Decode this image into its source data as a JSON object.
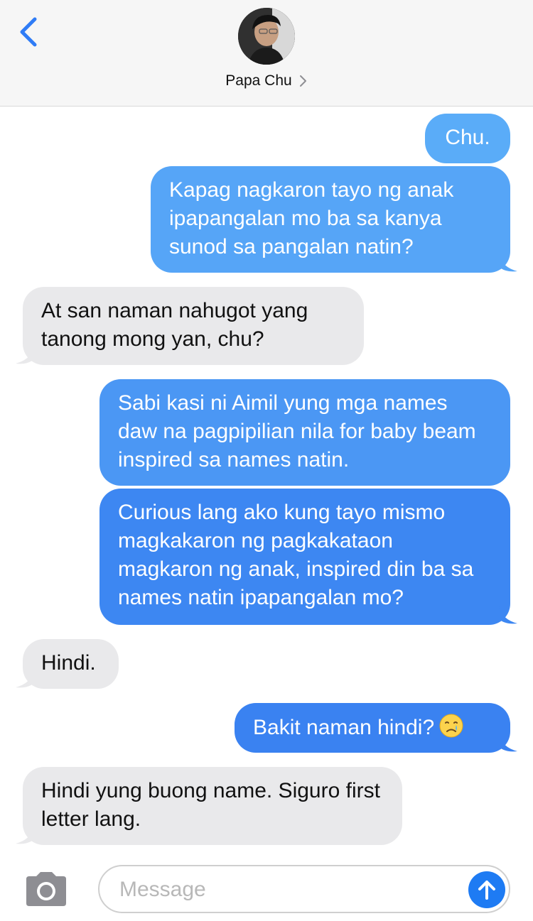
{
  "header": {
    "contact_name": "Papa Chu"
  },
  "messages": [
    {
      "side": "sent",
      "text": "Chu."
    },
    {
      "side": "sent",
      "text": "Kapag nagkaron tayo ng anak ipapangalan mo ba sa kanya sunod sa pangalan natin?"
    },
    {
      "side": "received",
      "text": "At san naman nahugot yang tanong mong yan, chu?"
    },
    {
      "side": "sent",
      "text": "Sabi kasi ni Aimil yung mga names daw na pagpipilian nila for baby beam inspired sa names natin."
    },
    {
      "side": "sent",
      "text": "Curious lang ako kung tayo mismo magkakaron ng pagkakataon magkaron ng anak, inspired din ba sa names natin ipapangalan mo?"
    },
    {
      "side": "received",
      "text": "Hindi."
    },
    {
      "side": "sent",
      "text": "Bakit naman hindi?",
      "emoji": "crying-face-icon"
    },
    {
      "side": "received",
      "text": "Hindi yung buong name. Siguro first letter lang."
    }
  ],
  "input": {
    "placeholder": "Message",
    "value": ""
  },
  "colors": {
    "accent": "#1e7bf3",
    "received_bubble": "#e9e9eb",
    "sent_top": "#5aacf8",
    "sent_bottom": "#3a82f1"
  }
}
